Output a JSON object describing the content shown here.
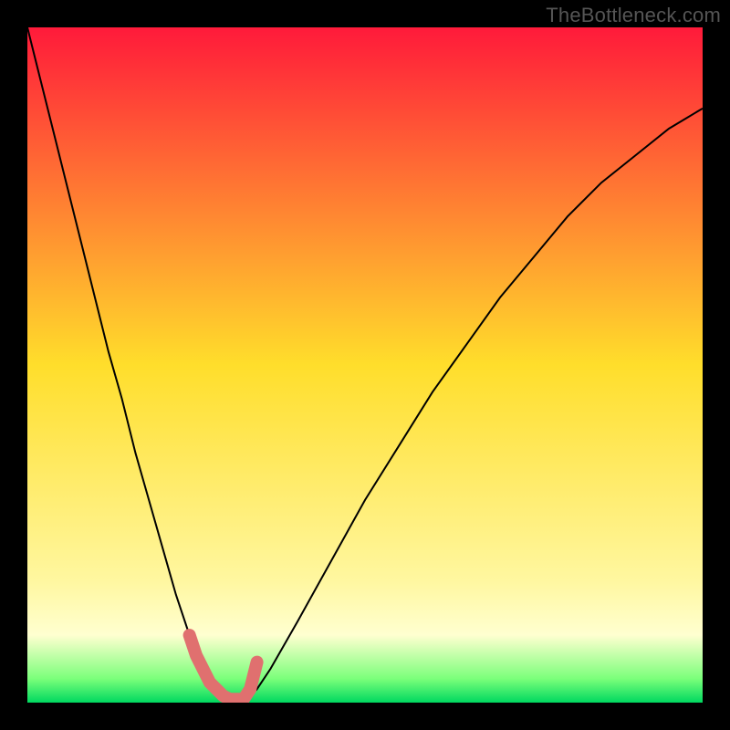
{
  "watermark": "TheBottleneck.com",
  "chart_data": {
    "type": "line",
    "title": "",
    "xlabel": "",
    "ylabel": "",
    "xlim": [
      0,
      100
    ],
    "ylim": [
      0,
      100
    ],
    "background_gradient": {
      "stops": [
        {
          "offset": 0.0,
          "color": "#ff1a3a"
        },
        {
          "offset": 0.5,
          "color": "#ffde2b"
        },
        {
          "offset": 0.82,
          "color": "#fff7a0"
        },
        {
          "offset": 0.9,
          "color": "#ffffd0"
        },
        {
          "offset": 0.965,
          "color": "#7aff7a"
        },
        {
          "offset": 1.0,
          "color": "#00d860"
        }
      ]
    },
    "series": [
      {
        "name": "bottleneck-curve",
        "color": "#000000",
        "stroke_width": 2,
        "x": [
          0,
          2,
          4,
          6,
          8,
          10,
          12,
          14,
          16,
          18,
          20,
          22,
          24,
          25,
          26,
          27,
          28,
          29,
          30,
          31,
          32,
          33,
          34,
          36,
          40,
          45,
          50,
          55,
          60,
          65,
          70,
          75,
          80,
          85,
          90,
          95,
          100
        ],
        "y": [
          100,
          92,
          84,
          76,
          68,
          60,
          52,
          45,
          37,
          30,
          23,
          16,
          10,
          7,
          5,
          3,
          2,
          1,
          0.5,
          0.5,
          0.5,
          1,
          2,
          5,
          12,
          21,
          30,
          38,
          46,
          53,
          60,
          66,
          72,
          77,
          81,
          85,
          88
        ]
      },
      {
        "name": "optimal-range-marker",
        "color": "#e0706f",
        "stroke_width": 14,
        "linecap": "round",
        "x": [
          24,
          25,
          26,
          27,
          28,
          29,
          30,
          31,
          32,
          33,
          34
        ],
        "y": [
          10,
          7,
          5,
          3,
          2,
          1,
          0.5,
          0.5,
          0.5,
          2,
          6
        ]
      }
    ]
  }
}
